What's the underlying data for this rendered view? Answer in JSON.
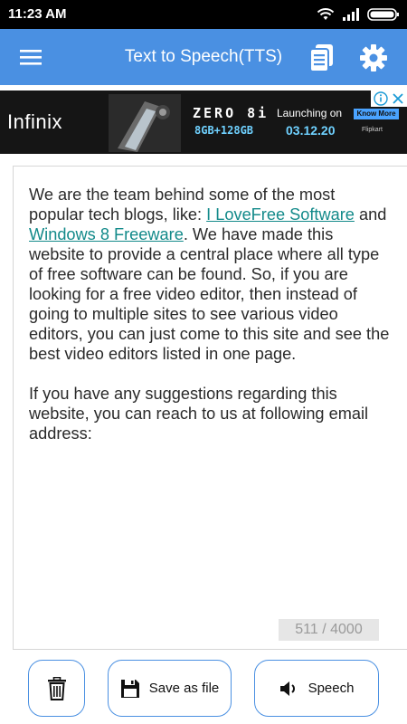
{
  "status_bar": {
    "time": "11:23 AM",
    "icons": [
      "wifi-icon",
      "signal-icon",
      "battery-icon"
    ]
  },
  "app_bar": {
    "title": "Text to Speech(TTS)",
    "icons": [
      "menu-icon",
      "copy-document-icon",
      "settings-gear-icon"
    ],
    "background_color": "#4a90e2"
  },
  "ad": {
    "brand": "Infinix",
    "model": "ZERO 8i",
    "specs": "8GB+128GB",
    "launch_label": "Launching on",
    "launch_date": "03.12.20",
    "cta": "Know More",
    "partner": "Flipkart"
  },
  "editor": {
    "paragraph1_part1": "We are the team behind some of the most popular tech blogs, like: ",
    "link1": "I LoveFree Software",
    "paragraph1_part2": " and ",
    "link2": "Windows 8 Freeware",
    "paragraph1_part3": ". We have made this website to provide a central place where all type of free software can be found. So, if you are looking for a free video editor, then instead of going to multiple sites to see various video editors, you can just come to this site and see the best video editors listed in one page.",
    "paragraph2": "If you have any suggestions regarding this website, you can reach to us at following email address:",
    "char_count": "511 / 4000",
    "link_color": "#138a8a"
  },
  "actions": {
    "delete_icon": "trash-icon",
    "save_label": "Save as file",
    "save_icon": "floppy-disk-icon",
    "speech_label": "Speech",
    "speech_icon": "speaker-icon"
  }
}
